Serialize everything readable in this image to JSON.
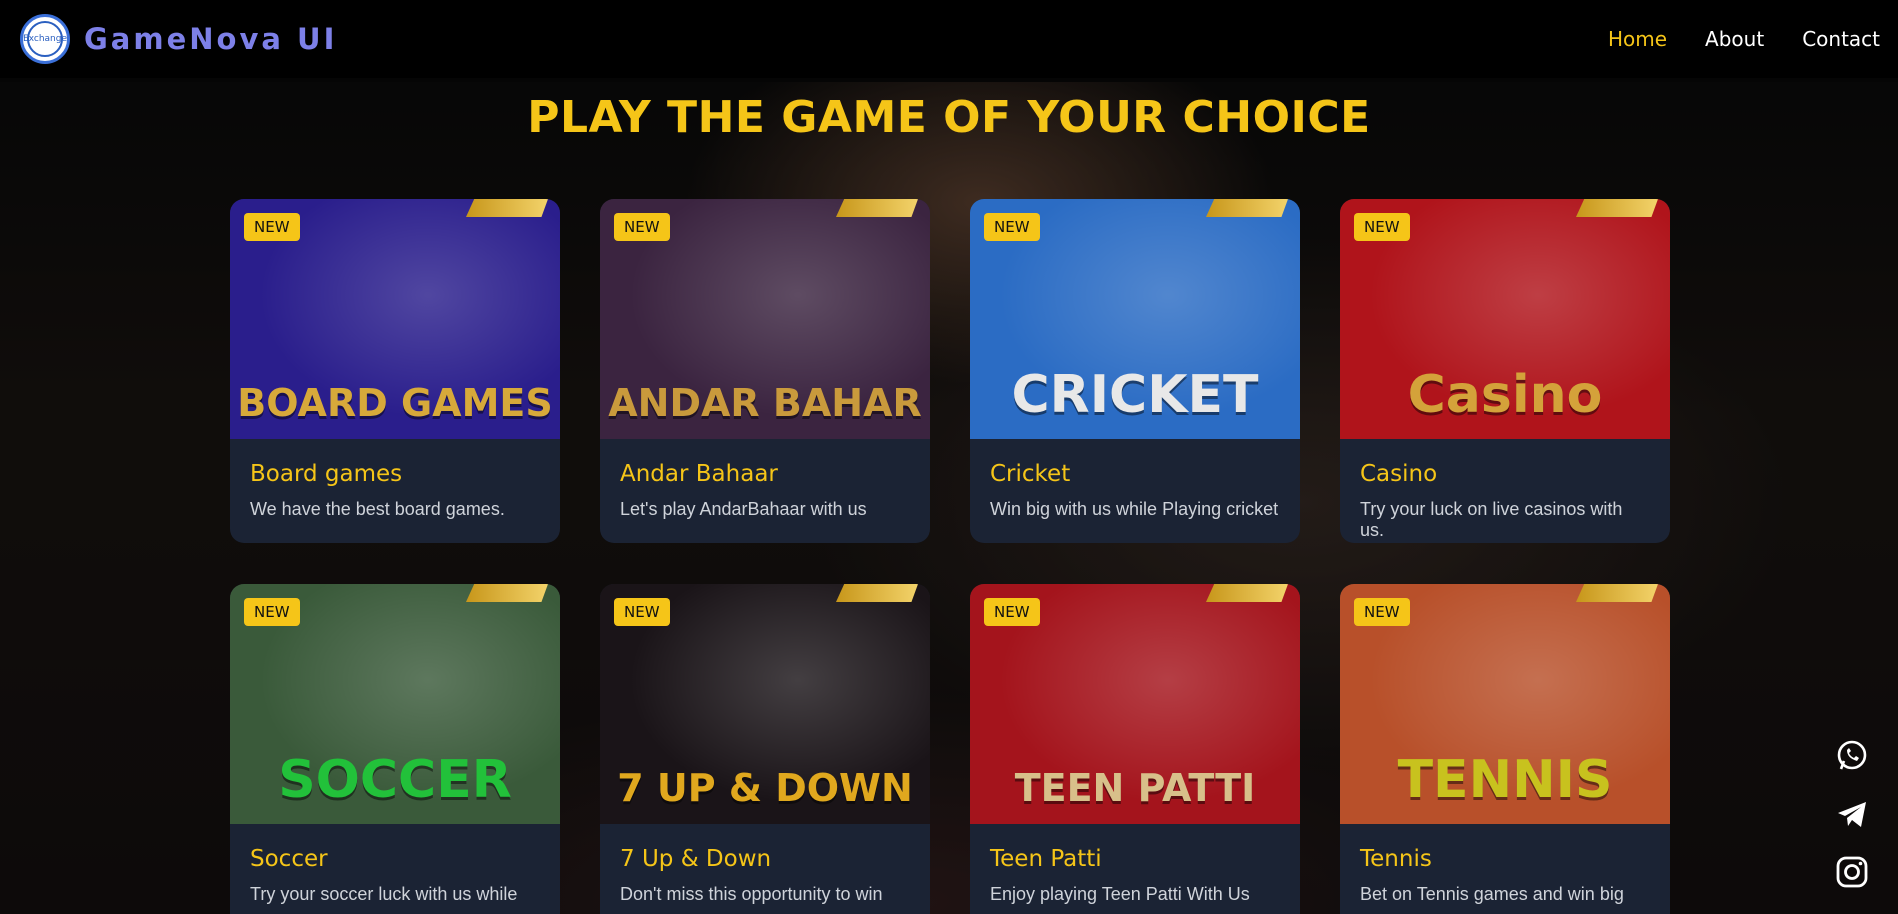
{
  "header": {
    "brand": "GameNova UI",
    "logo_text": "Exchange",
    "nav": [
      {
        "label": "Home",
        "active": true
      },
      {
        "label": "About",
        "active": false
      },
      {
        "label": "Contact",
        "active": false
      }
    ]
  },
  "hero": {
    "title": "PLAY THE GAME OF YOUR CHOICE"
  },
  "cards": [
    {
      "badge": "NEW",
      "art": "BOARD GAMES",
      "title": "Board games",
      "desc": "We have the best board games.",
      "bg": "#2a1e8c",
      "art_color": "#d7a93a"
    },
    {
      "badge": "NEW",
      "art": "ANDAR BAHAR",
      "title": "Andar Bahaar",
      "desc": "Let's play AndarBahaar with us",
      "bg": "#3b2440",
      "art_color": "#c99a3c"
    },
    {
      "badge": "NEW",
      "art": "CRICKET",
      "title": "Cricket",
      "desc": "Win big with us while Playing cricket",
      "bg": "#2b6cc4",
      "art_color": "#e8e8e8"
    },
    {
      "badge": "NEW",
      "art": "Casino",
      "title": "Casino",
      "desc": "Try your luck on live casinos with us.",
      "bg": "#b0141b",
      "art_color": "#d4a23a"
    },
    {
      "badge": "NEW",
      "art": "SOCCER",
      "title": "Soccer",
      "desc": "Try your soccer luck with us while",
      "bg": "#3a5a3a",
      "art_color": "#22c13a"
    },
    {
      "badge": "NEW",
      "art": "7 UP & DOWN",
      "title": "7 Up & Down",
      "desc": "Don't miss this opportunity to win",
      "bg": "#1a1418",
      "art_color": "#e0a81e"
    },
    {
      "badge": "NEW",
      "art": "TEEN PATTI",
      "title": "Teen Patti",
      "desc": "Enjoy playing Teen Patti With Us",
      "bg": "#a4141c",
      "art_color": "#d8c08a"
    },
    {
      "badge": "NEW",
      "art": "TENNIS",
      "title": "Tennis",
      "desc": "Bet on Tennis games and win big",
      "bg": "#b8502a",
      "art_color": "#c8c21e"
    }
  ],
  "social": [
    "whatsapp-icon",
    "telegram-icon",
    "instagram-icon"
  ]
}
